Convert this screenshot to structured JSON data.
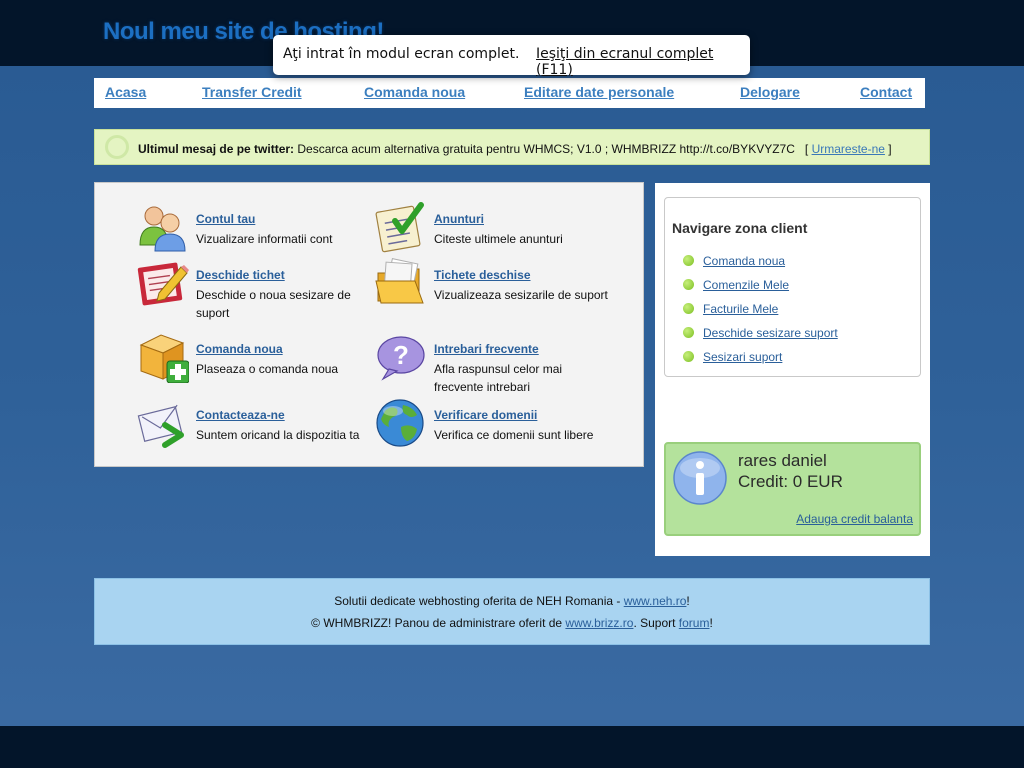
{
  "header": {
    "site_title": "Noul meu site de hosting!"
  },
  "fullscreen_notice": {
    "message": "Aţi intrat în modul ecran complet.",
    "exit_label": "Ieşiţi din ecranul complet (F11)"
  },
  "nav": {
    "items": [
      {
        "label": "Acasa"
      },
      {
        "label": "Transfer Credit"
      },
      {
        "label": "Comanda noua"
      },
      {
        "label": "Editare date personale"
      },
      {
        "label": "Delogare"
      },
      {
        "label": "Contact"
      }
    ]
  },
  "twitter": {
    "prefix": "Ultimul mesaj de pe twitter:",
    "message": "Descarca acum alternativa gratuita pentru WHMCS; V1.0 ; WHMBRIZZ http://t.co/BYKVYZ7C",
    "bracket_open": "[",
    "follow_label": "Urmareste-ne",
    "bracket_close": "]"
  },
  "main": {
    "items": [
      {
        "title": "Contul tau",
        "desc": "Vizualizare informatii cont",
        "icon": "users-icon"
      },
      {
        "title": "Anunturi",
        "desc": "Citeste ultimele anunturi",
        "icon": "checklist-icon"
      },
      {
        "title": "Deschide tichet",
        "desc": "Deschide o noua sesizare de suport",
        "icon": "ticket-pencil-icon"
      },
      {
        "title": "Tichete deschise",
        "desc": "Vizualizeaza sesizarile de suport",
        "icon": "folder-icon"
      },
      {
        "title": "Comanda noua",
        "desc": "Plaseaza o comanda noua",
        "icon": "box-add-icon"
      },
      {
        "title": "Intrebari frecvente",
        "desc": "Afla raspunsul celor mai frecvente intrebari",
        "icon": "question-bubble-icon"
      },
      {
        "title": "Contacteaza-ne",
        "desc": "Suntem oricand la dispozitia ta",
        "icon": "envelope-icon"
      },
      {
        "title": "Verificare domenii",
        "desc": "Verifica ce domenii sunt libere",
        "icon": "globe-icon"
      }
    ]
  },
  "sidebar": {
    "nav_title": "Navigare zona client",
    "links": [
      {
        "label": "Comanda noua"
      },
      {
        "label": "Comenzile Mele"
      },
      {
        "label": "Facturile Mele"
      },
      {
        "label": "Deschide sesizare suport"
      },
      {
        "label": "Sesizari suport"
      }
    ],
    "user_name": "rares daniel",
    "credit_text": "Credit: 0 EUR",
    "add_credit_label": "Adauga credit balanta"
  },
  "footer": {
    "line1_text": "Solutii dedicate webhosting oferita de NEH Romania - ",
    "line1_link": "www.neh.ro",
    "line1_end": "!",
    "line2_text": "© WHMBRIZZ! Panou de administrare oferit de ",
    "line2_link": "www.brizz.ro",
    "line2_mid": ". Suport ",
    "line2_link2": "forum",
    "line2_end": "!"
  },
  "colors": {
    "link": "#2a5f9a",
    "nav_link": "#3c7fbf",
    "twitter_bg": "#e4f4c2",
    "credit_bg": "#b4e29c",
    "footer_bg": "#a9d4f1",
    "dark_bar": "#03152a"
  }
}
